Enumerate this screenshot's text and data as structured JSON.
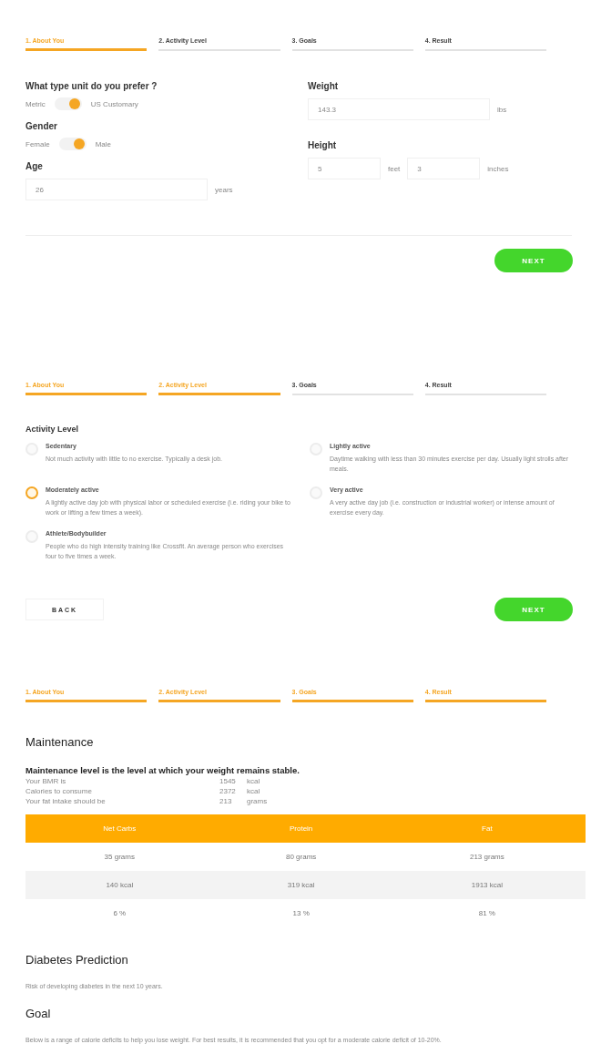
{
  "panels": [
    {
      "kind": "about",
      "steps": [
        {
          "label": "1. About You",
          "active": true
        },
        {
          "label": "2. Activity Level",
          "active": false
        },
        {
          "label": "3. Goals",
          "active": false
        },
        {
          "label": "4. Result",
          "active": false
        }
      ],
      "unit": {
        "label": "What type unit do you prefer ?",
        "left": "Metric",
        "right": "US Customary",
        "on": true
      },
      "gender": {
        "label": "Gender",
        "left": "Female",
        "right": "Male",
        "on": true
      },
      "age": {
        "label": "Age",
        "value": "26",
        "unit": "years"
      },
      "weight": {
        "label": "Weight",
        "value": "143.3",
        "unit": "lbs"
      },
      "height": {
        "label": "Height",
        "feet": "5",
        "feet_unit": "feet",
        "inches": "3",
        "inches_unit": "inches"
      },
      "buttons": [
        {
          "kind": "next",
          "label": "NEXT"
        }
      ]
    },
    {
      "kind": "activity",
      "steps": [
        {
          "label": "1. About You",
          "active": true
        },
        {
          "label": "2. Activity Level",
          "active": true
        },
        {
          "label": "3. Goals",
          "active": false
        },
        {
          "label": "4. Result",
          "active": false
        }
      ],
      "title": "Activity Level",
      "options": [
        {
          "name": "Sedentary",
          "description": "Not much activity with little to no exercise. Typically a desk job.",
          "selected": false
        },
        {
          "name": "Lightly active",
          "description": "Daytime walking with less than 30 minutes exercise per day. Usually light strolls after meals.",
          "selected": false
        },
        {
          "name": "Moderately active",
          "description": "A lightly active day job with physical labor or scheduled exercise (i.e. riding your bike to work or lifting a few times a week).",
          "selected": true
        },
        {
          "name": "Very active",
          "description": "A very active day job (i.e. construction or industrial worker) or intense amount of exercise every day.",
          "selected": false
        },
        {
          "name": "Athlete/Bodybuilder",
          "description": "People who do high intensity training like Crossfit. An average person who exercises four to five times a week.",
          "selected": false
        }
      ],
      "buttons": [
        {
          "kind": "back",
          "label": "BACK"
        },
        {
          "kind": "next",
          "label": "NEXT"
        }
      ]
    },
    {
      "kind": "result",
      "steps": [
        {
          "label": "1. About You",
          "active": true
        },
        {
          "label": "2. Activity Level",
          "active": true
        },
        {
          "label": "3. Goals",
          "active": true
        },
        {
          "label": "4. Result",
          "active": true
        }
      ],
      "maintenance": {
        "title": "Maintenance",
        "subtitle": "Maintenance level is the level at which your weight remains stable.",
        "facts": [
          {
            "label": "Your BMR is",
            "value": "1545",
            "unit": "kcal"
          },
          {
            "label": "Calories to consume",
            "value": "2372",
            "unit": "kcal"
          },
          {
            "label": "Your fat intake should be",
            "value": "213",
            "unit": "grams"
          }
        ],
        "table": {
          "columns": [
            "Net Carbs",
            "Protein",
            "Fat"
          ],
          "rows": [
            [
              "35 grams",
              "80 grams",
              "213 grams"
            ],
            [
              "140 kcal",
              "319 kcal",
              "1913 kcal"
            ],
            [
              "6 %",
              "13 %",
              "81 %"
            ]
          ]
        }
      },
      "diabetes": {
        "title": "Diabetes Prediction",
        "text": "Risk of developing diabetes in the next 10 years."
      },
      "goal": {
        "title": "Goal",
        "text": "Below is a range of calorie deficits to help you lose weight. For best results, it is recommended that you opt for a moderate calorie deficit of 10-20%."
      }
    }
  ]
}
